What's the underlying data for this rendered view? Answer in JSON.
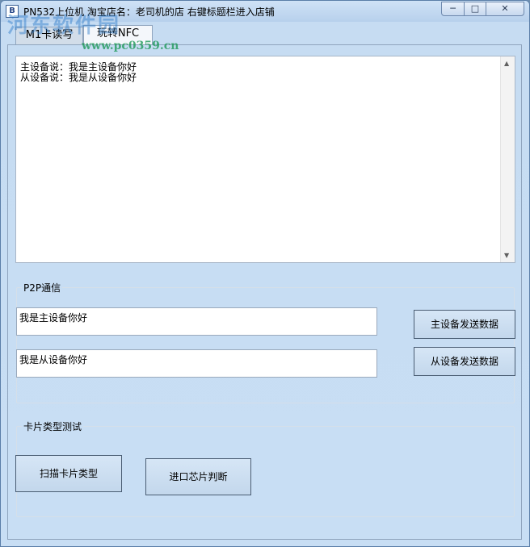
{
  "window": {
    "icon_letter": "B",
    "title": "PN532上位机 淘宝店名：老司机的店 右键标题栏进入店铺",
    "minimize_glyph": "─",
    "maximize_glyph": "□",
    "close_glyph": "✕"
  },
  "watermark": {
    "text": "河东软件园",
    "url": "www.pc0359.cn"
  },
  "tabs": [
    {
      "label": "M1卡读写"
    },
    {
      "label": "玩转NFC"
    }
  ],
  "log": {
    "lines": [
      "主设备说：我是主设备你好",
      "从设备说：我是从设备你好"
    ]
  },
  "p2p": {
    "legend": "P2P通信",
    "master_input": "我是主设备你好",
    "slave_input": "我是从设备你好",
    "master_send_button": "主设备发送数据",
    "slave_send_button": "从设备发送数据"
  },
  "card_test": {
    "legend": "卡片类型测试",
    "scan_button": "扫描卡片类型",
    "chip_button": "进口芯片判断"
  }
}
